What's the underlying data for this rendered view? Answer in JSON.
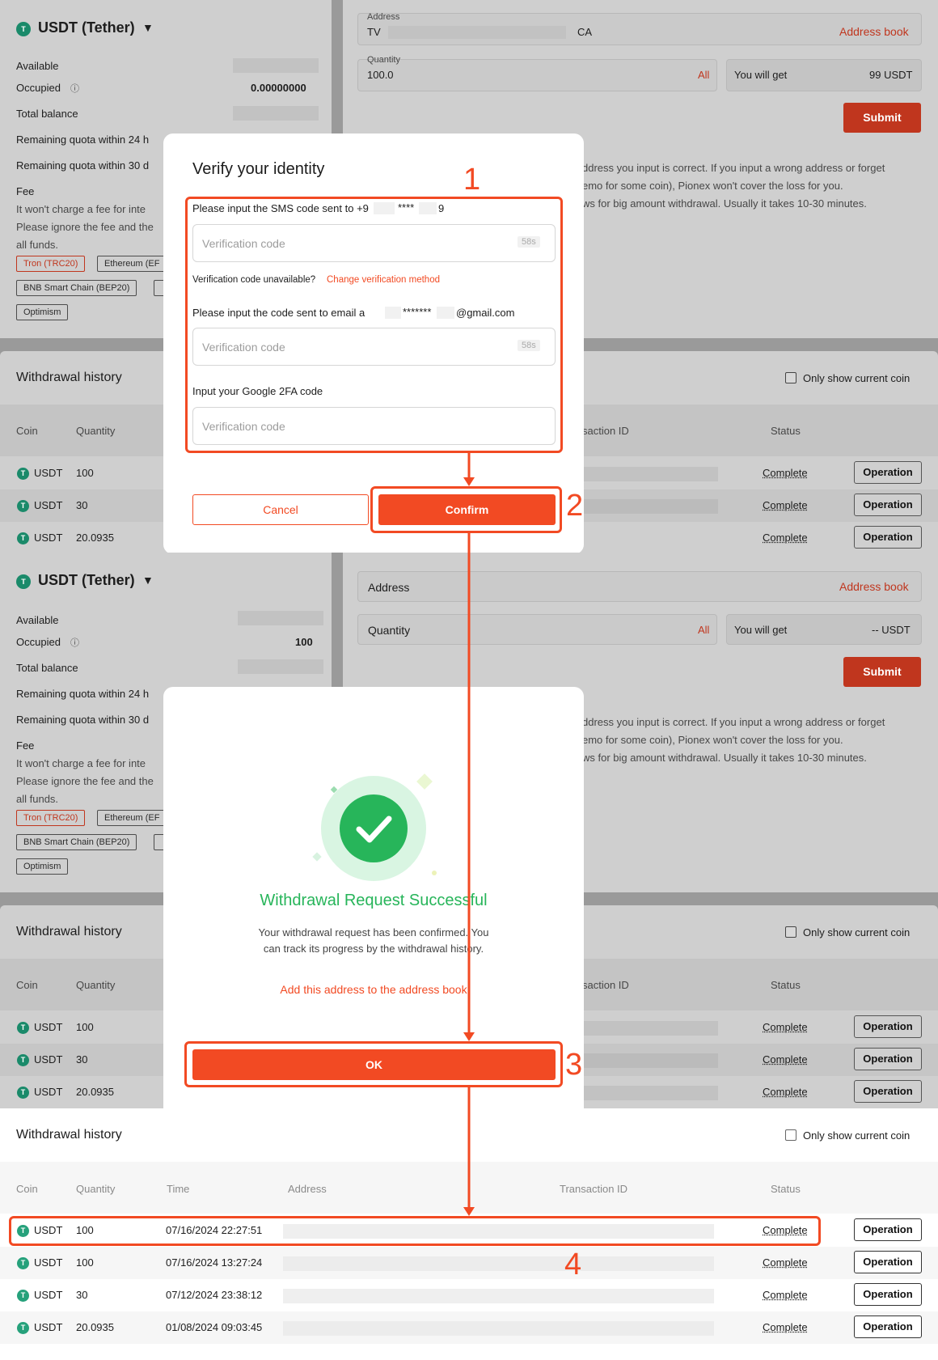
{
  "top": {
    "coin_title": "USDT (Tether)",
    "available_label": "Available",
    "occupied_label": "Occupied",
    "occupied_value": "0.00000000",
    "total_label": "Total balance",
    "quota24_label": "Remaining quota within 24 h",
    "quota30_label": "Remaining quota within 30 d",
    "fee_label": "Fee",
    "fee_line1": "It won't charge a fee for inte",
    "fee_line2": "Please ignore the fee and the",
    "fee_line3": "all funds.",
    "chips": [
      "Tron (TRC20)",
      "Ethereum (EF",
      "BNB Smart Chain (BEP20)",
      "Optimism"
    ],
    "address_label": "Address",
    "address_value_start": "TV",
    "address_value_end": "CA",
    "address_book": "Address book",
    "quantity_label": "Quantity",
    "quantity_value": "100.0",
    "all_label": "All",
    "you_will_get": "You will get",
    "get_value": "99 USDT",
    "submit": "Submit",
    "notice1": "ddress you input is correct. If you input a wrong address or forget",
    "notice2": "emo for some coin), Pionex won't cover the loss for you.",
    "notice3": "ws for big amount withdrawal. Usually it takes 10-30 minutes.",
    "history_title": "Withdrawal history",
    "only_current": "Only show current coin",
    "col_coin": "Coin",
    "col_quantity": "Quantity",
    "col_txid": "saction ID",
    "col_status": "Status",
    "rows": [
      {
        "coin": "USDT",
        "qty": "100",
        "status": "Complete",
        "op": "Operation"
      },
      {
        "coin": "USDT",
        "qty": "30",
        "status": "Complete",
        "op": "Operation"
      },
      {
        "coin": "USDT",
        "qty": "20.0935",
        "status": "Complete",
        "op": "Operation"
      }
    ]
  },
  "verify": {
    "title": "Verify your identity",
    "sms_label": "Please input the SMS code sent to +9",
    "sms_mask": "****",
    "sms_end": "9",
    "placeholder": "Verification code",
    "countdown": "58s",
    "unavailable": "Verification code unavailable?",
    "change_method": "Change verification method",
    "email_label": "Please input the code sent to email a",
    "email_mask": "*******",
    "email_end": "@gmail.com",
    "google_label": "Input your Google 2FA code",
    "cancel": "Cancel",
    "confirm": "Confirm"
  },
  "mid": {
    "coin_title": "USDT (Tether)",
    "available_label": "Available",
    "occupied_label": "Occupied",
    "occupied_value": "100",
    "total_label": "Total balance",
    "quota24_label": "Remaining quota within 24 h",
    "quota30_label": "Remaining quota within 30 d",
    "fee_label": "Fee",
    "fee_line1": "It won't charge a fee for inte",
    "fee_line2": "Please ignore the fee and the",
    "fee_line3": "all funds.",
    "chips": [
      "Tron (TRC20)",
      "Ethereum (EF",
      "BNB Smart Chain (BEP20)",
      "Optimism"
    ],
    "address_label": "Address",
    "address_book": "Address book",
    "quantity_label": "Quantity",
    "all_label": "All",
    "you_will_get": "You will get",
    "get_value": "-- USDT",
    "submit": "Submit",
    "notice1": "ddress you input is correct. If you input a wrong address or forget",
    "notice2": "emo for some coin), Pionex won't cover the loss for you.",
    "notice3": "ws for big amount withdrawal. Usually it takes 10-30 minutes.",
    "history_title": "Withdrawal history",
    "only_current": "Only show current coin",
    "col_coin": "Coin",
    "col_quantity": "Quantity",
    "col_txid": "saction ID",
    "col_status": "Status",
    "rows": [
      {
        "coin": "USDT",
        "qty": "100",
        "status": "Complete",
        "op": "Operation"
      },
      {
        "coin": "USDT",
        "qty": "30",
        "status": "Complete",
        "op": "Operation"
      },
      {
        "coin": "USDT",
        "qty": "20.0935",
        "status": "Complete",
        "op": "Operation"
      }
    ]
  },
  "success": {
    "title": "Withdrawal Request Successful",
    "desc1": "Your withdrawal request has been confirmed. You",
    "desc2": "can track its progress by the withdrawal history.",
    "add_address": "Add this address to the address book",
    "ok": "OK"
  },
  "history": {
    "title": "Withdrawal history",
    "only_current": "Only show current coin",
    "col_coin": "Coin",
    "col_quantity": "Quantity",
    "col_time": "Time",
    "col_address": "Address",
    "col_txid": "Transaction ID",
    "col_status": "Status",
    "rows": [
      {
        "coin": "USDT",
        "qty": "100",
        "time": "07/16/2024 22:27:51",
        "status": "Complete",
        "op": "Operation"
      },
      {
        "coin": "USDT",
        "qty": "100",
        "time": "07/16/2024 13:27:24",
        "status": "Complete",
        "op": "Operation"
      },
      {
        "coin": "USDT",
        "qty": "30",
        "time": "07/12/2024 23:38:12",
        "status": "Complete",
        "op": "Operation"
      },
      {
        "coin": "USDT",
        "qty": "20.0935",
        "time": "01/08/2024 09:03:45",
        "status": "Complete",
        "op": "Operation"
      }
    ]
  },
  "steps": [
    "1",
    "2",
    "3",
    "4"
  ],
  "colors": {
    "accent": "#f24a23",
    "success": "#27b55a",
    "tether": "#26a17b"
  }
}
